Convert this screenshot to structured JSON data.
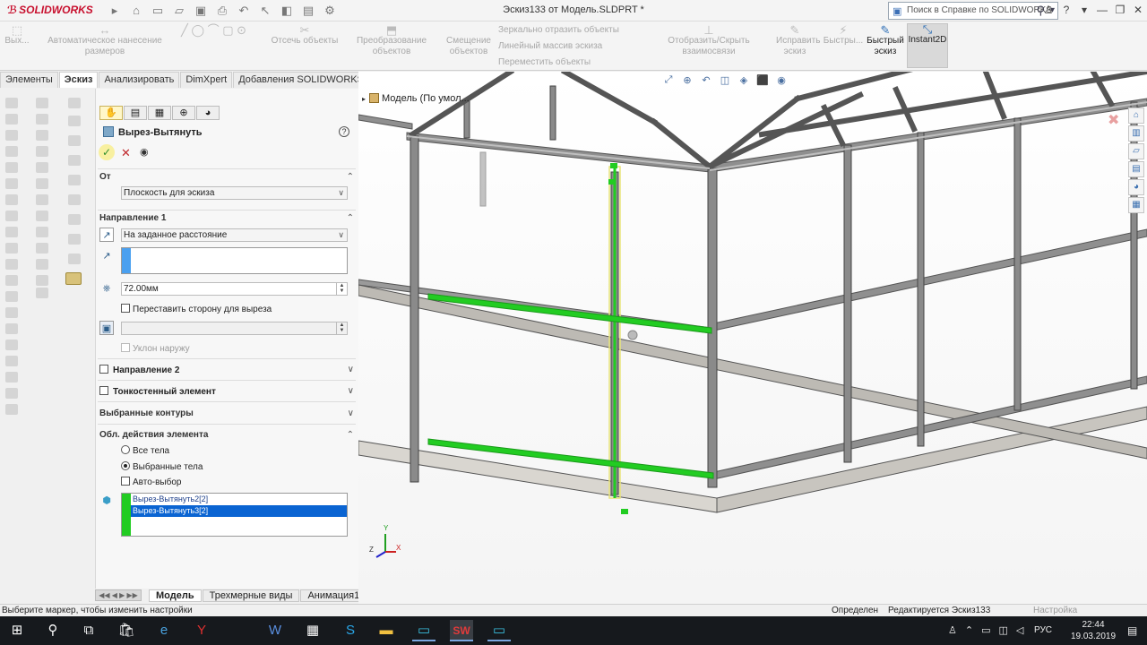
{
  "app": {
    "logo": "SOLIDWORKS",
    "document_title": "Эскиз133 от Модель.SLDPRT *",
    "help_search_placeholder": "Поиск в Справке по SOLIDWORKS"
  },
  "ribbon": {
    "exit_label": "Вых...",
    "auto_dim_label": "Автоматическое нанесение размеров",
    "trim_label": "Отсечь объекты",
    "convert_label": "Преобразование объектов",
    "offset_label": "Смещение объектов",
    "mirror_label": "Зеркально отразить объекты",
    "linear_pattern_label": "Линейный массив эскиза",
    "move_label": "Переместить объекты",
    "show_relations_label": "Отобразить/Скрыть взаимосвязи",
    "repair_label": "Исправить эскиз",
    "rapid_label": "Быстры...",
    "quick_sketch_label": "Быстрый эскиз",
    "instant2d_label": "Instant2D"
  },
  "tabs": [
    "Элементы",
    "Эскиз",
    "Анализировать",
    "DimXpert",
    "Добавления SOLIDWORKS"
  ],
  "active_tab_index": 1,
  "property_manager": {
    "title": "Вырез-Вытянуть",
    "help": "?",
    "ok": "✓",
    "cancel": "✕",
    "preview": "👁",
    "from": {
      "label": "От",
      "value": "Плоскость для эскиза"
    },
    "direction1": {
      "label": "Направление 1",
      "end_condition": "На заданное расстояние",
      "depth": "72.00мм",
      "flip_side_label": "Переставить сторону для выреза",
      "draft_outward_label": "Уклон наружу"
    },
    "direction2_label": "Направление 2",
    "thin_feature_label": "Тонкостенный элемент",
    "selected_contours_label": "Выбранные контуры",
    "feature_scope": {
      "label": "Обл. действия элемента",
      "all_bodies": "Все тела",
      "selected_bodies": "Выбранные тела",
      "auto_select": "Авто-выбор",
      "bodies": [
        "Вырез-Вытянуть2[2]",
        "Вырез-Вытянуть3[2]"
      ],
      "selected_body_index": 1
    }
  },
  "bottom_tabs": [
    "Модель",
    "Трехмерные виды",
    "Анимация1"
  ],
  "status": {
    "message": "Выберите маркер, чтобы изменить настройки",
    "state": "Определен",
    "editing": "Редактируется Эскиз133",
    "settings": "Настройка"
  },
  "viewport": {
    "tree_label": "Модель  (По умол..."
  },
  "taskbar": {
    "lang": "РУС",
    "time": "22:44",
    "date": "19.03.2019"
  },
  "colors": {
    "accent_green": "#22cc22",
    "selection_blue": "#0a64d2",
    "frame_gray": "#8a8a8a"
  }
}
